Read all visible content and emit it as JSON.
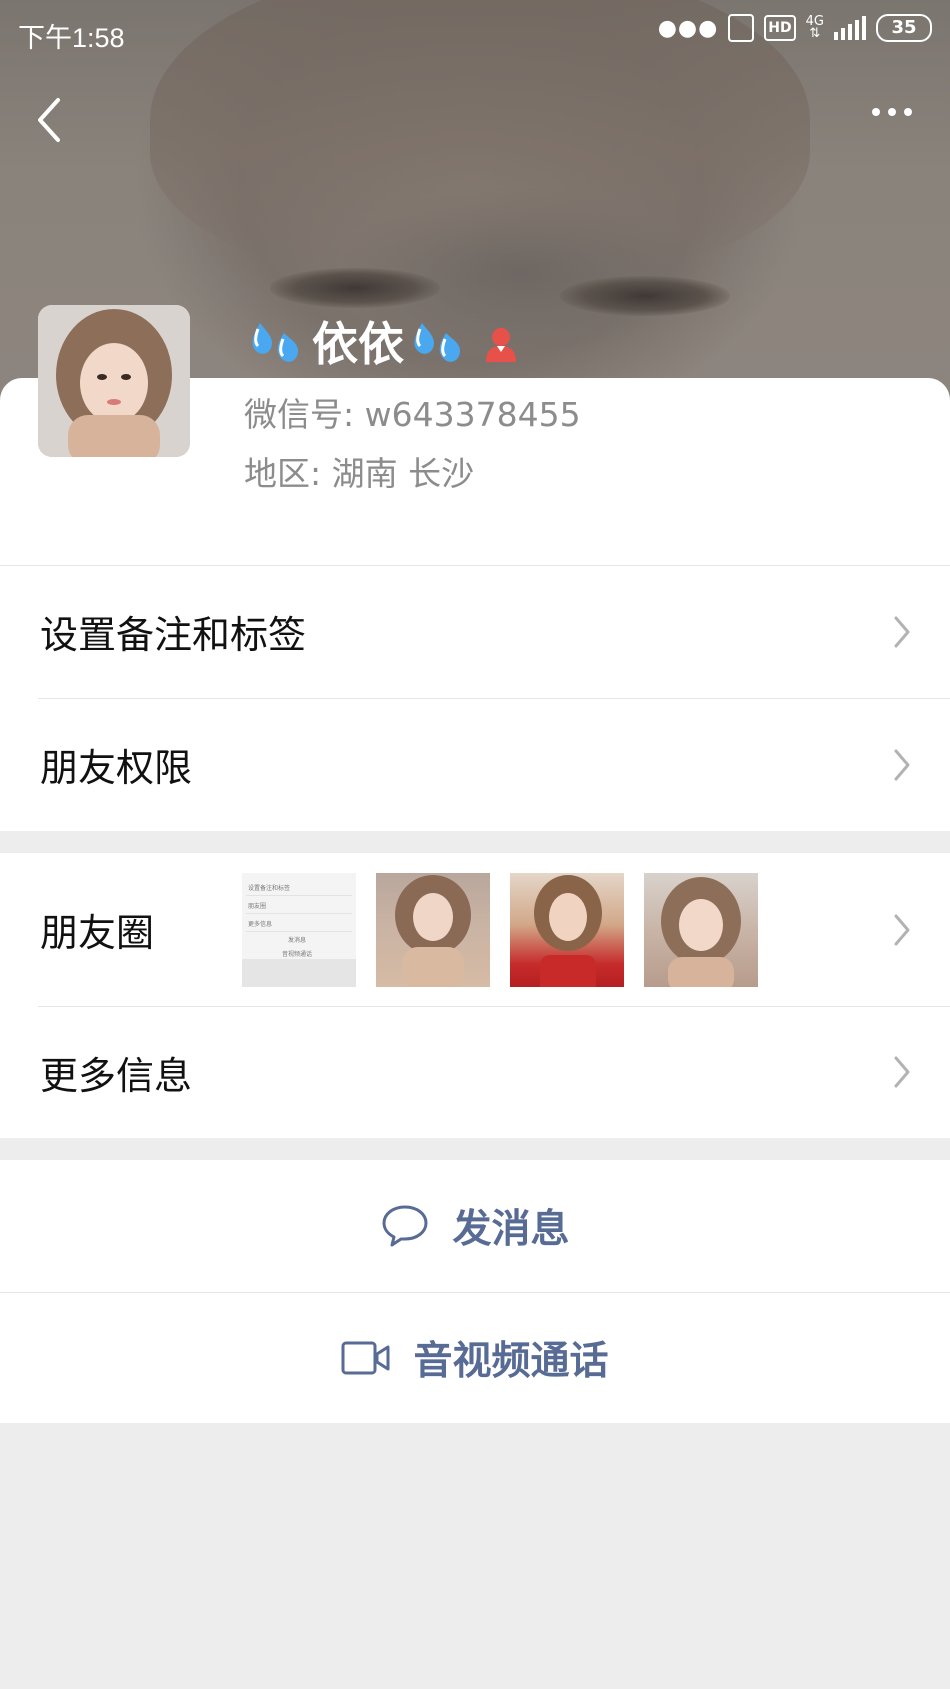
{
  "status_bar": {
    "time": "下午1:58",
    "network": "4G",
    "hd": "HD",
    "battery": "35"
  },
  "nav": {
    "back_icon": "chevron-left-icon",
    "more_icon": "more-dots-icon"
  },
  "profile": {
    "nickname": "依依",
    "nickname_emoji": "sweat-droplets-emoji",
    "gender_icon": "female-icon",
    "wechat_id": "微信号:  w643378455",
    "region": "地区:  湖南  长沙"
  },
  "menu": {
    "remark_tags": "设置备注和标签",
    "friend_permissions": "朋友权限",
    "moments": "朋友圈",
    "more_info": "更多信息"
  },
  "moments_thumbnails": {
    "screenshot_rows": [
      "设置备注和标签",
      "朋友圈",
      "更多信息"
    ],
    "screenshot_actions": [
      "发消息",
      "音视频通话"
    ]
  },
  "actions": {
    "send_message": "发消息",
    "av_call": "音视频通话"
  },
  "colors": {
    "link_blue": "#576b95",
    "page_bg": "#ededed",
    "gender_red": "#e8514a"
  }
}
